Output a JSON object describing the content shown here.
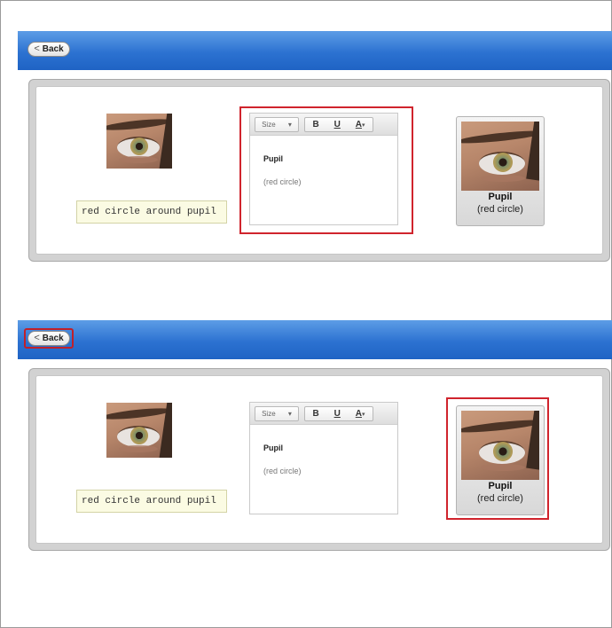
{
  "back_label": "Back",
  "back_chevron": "<",
  "note": "red circle around pupil",
  "editor": {
    "size_label": "Size",
    "size_arrow": "▾",
    "bold": "B",
    "underline": "U",
    "font_color": "A",
    "font_color_arrow": "▾",
    "title": "Pupil",
    "subtitle": "(red circle)"
  },
  "preview": {
    "title": "Pupil",
    "subtitle": "(red circle)"
  },
  "highlight_color": "#d0242d",
  "header_color": "#2c72d1"
}
